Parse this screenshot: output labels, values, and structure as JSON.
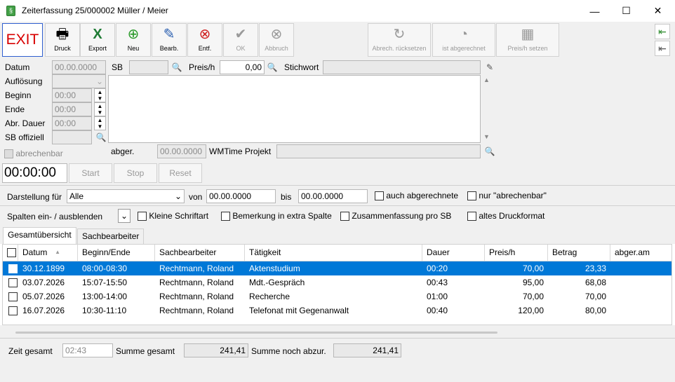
{
  "window": {
    "title": "Zeiterfassung 25/000002 Müller / Meier",
    "app_icon": "§",
    "minimize": "—",
    "maximize": "☐",
    "close": "✕"
  },
  "toolbar": {
    "exit": "EXIT",
    "druck": "Druck",
    "export": "Export",
    "neu": "Neu",
    "bearb": "Bearb.",
    "entf": "Entf.",
    "ok": "OK",
    "abbruch": "Abbruch",
    "abrech_ruecksetzen": "Abrech. rücksetzen",
    "ist_abgerechnet": "ist abgerechnet",
    "preis_setzen": "Preis/h setzen"
  },
  "form": {
    "datum_label": "Datum",
    "datum_value": "00.00.0000",
    "sb_label": "SB",
    "preis_label": "Preis/h",
    "preis_value": "0,00",
    "stichwort_label": "Stichwort",
    "aufloesung_label": "Auflösung",
    "beginn_label": "Beginn",
    "beginn_value": "00:00",
    "ende_label": "Ende",
    "ende_value": "00:00",
    "abr_dauer_label": "Abr. Dauer",
    "abr_dauer_value": "00:00",
    "sb_offiziell_label": "SB offiziell",
    "abrechenbar_label": "abrechenbar",
    "abger_label": "abger.",
    "abger_value": "00.00.0000",
    "wmtime_label": "WMTime Projekt",
    "timer": "00:00:00",
    "start": "Start",
    "stop": "Stop",
    "reset": "Reset"
  },
  "filter": {
    "darstellung_label": "Darstellung für",
    "darstellung_value": "Alle",
    "von_label": "von",
    "von_value": "00.00.0000",
    "bis_label": "bis",
    "bis_value": "00.00.0000",
    "auch_abgerechnete": "auch abgerechnete",
    "nur_abrechenbar": "nur \"abrechenbar\"",
    "spalten_label": "Spalten ein- / ausblenden",
    "kleine_schrift": "Kleine Schriftart",
    "bemerkung": "Bemerkung in extra Spalte",
    "zusammenfassung": "Zusammenfassung pro SB",
    "altes_druck": "altes Druckformat"
  },
  "tabs": [
    "Gesamtübersicht",
    "Sachbearbeiter"
  ],
  "table": {
    "columns": [
      "Datum",
      "Beginn/Ende",
      "Sachbearbeiter",
      "Tätigkeit",
      "Dauer",
      "Preis/h",
      "Betrag",
      "abger.am"
    ],
    "rows": [
      {
        "datum": "30.12.1899",
        "beginn_ende": "08:00-08:30",
        "sb": "Rechtmann, Roland",
        "taetigkeit": "Aktenstudium",
        "dauer": "00:20",
        "preis": "70,00",
        "betrag": "23,33",
        "abger": "",
        "selected": true
      },
      {
        "datum": "03.07.2026",
        "beginn_ende": "15:07-15:50",
        "sb": "Rechtmann, Roland",
        "taetigkeit": "Mdt.-Gespräch",
        "dauer": "00:43",
        "preis": "95,00",
        "betrag": "68,08",
        "abger": ""
      },
      {
        "datum": "05.07.2026",
        "beginn_ende": "13:00-14:00",
        "sb": "Rechtmann, Roland",
        "taetigkeit": "Recherche",
        "dauer": "01:00",
        "preis": "70,00",
        "betrag": "70,00",
        "abger": ""
      },
      {
        "datum": "16.07.2026",
        "beginn_ende": "10:30-11:10",
        "sb": "Rechtmann, Roland",
        "taetigkeit": "Telefonat mit Gegenanwalt",
        "dauer": "00:40",
        "preis": "120,00",
        "betrag": "80,00",
        "abger": ""
      }
    ]
  },
  "footer": {
    "zeit_gesamt_label": "Zeit gesamt",
    "zeit_gesamt_value": "02:43",
    "summe_gesamt_label": "Summe gesamt",
    "summe_gesamt_value": "241,41",
    "summe_noch_label": "Summe noch abzur.",
    "summe_noch_value": "241,41"
  },
  "colors": {
    "selection": "#0078d7",
    "exit_text": "#d80000",
    "exit_border": "#2f5fd0"
  }
}
